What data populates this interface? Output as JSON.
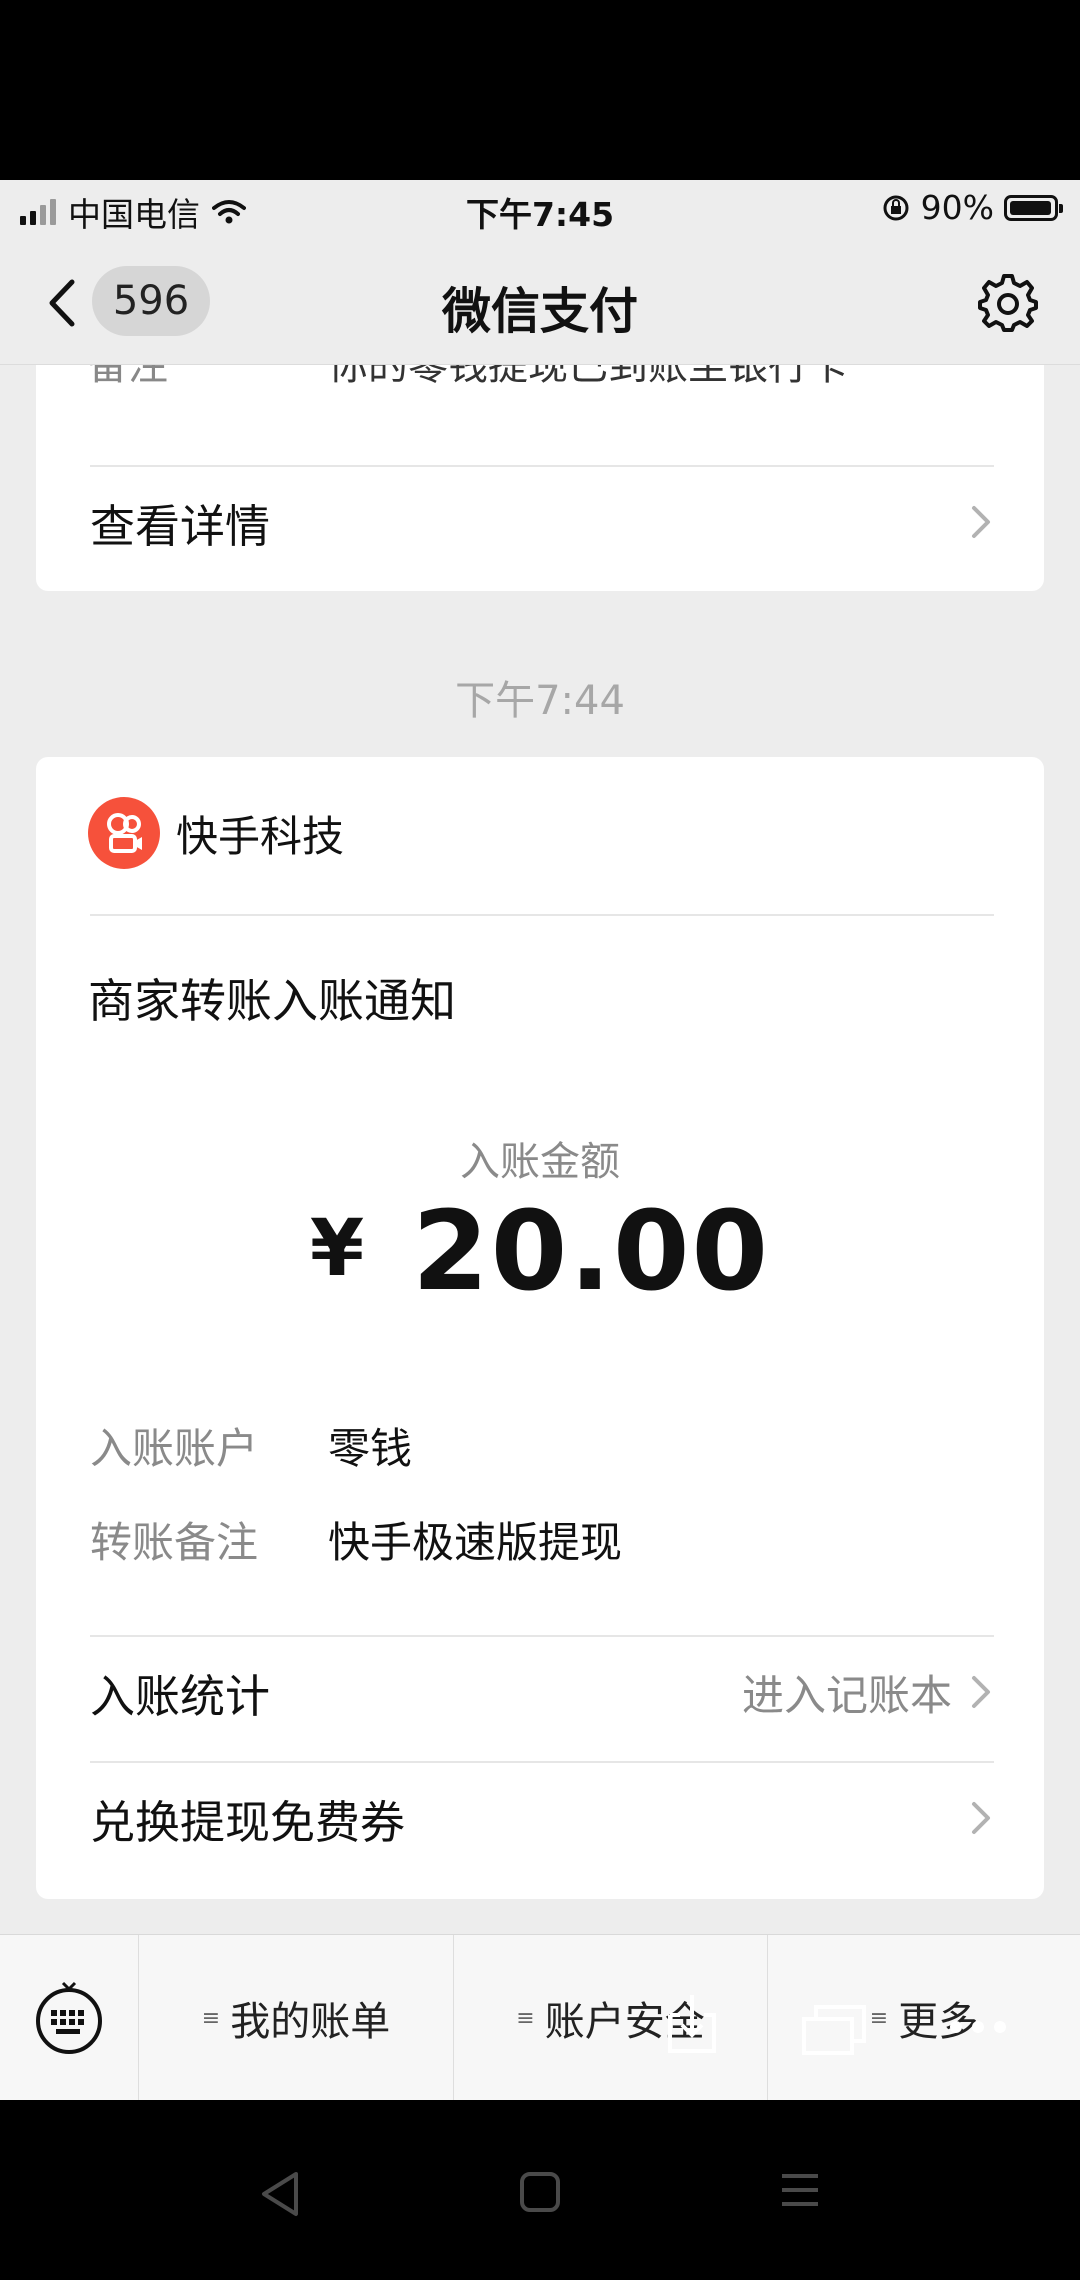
{
  "status_bar": {
    "carrier": "中国电信",
    "time": "下午7:45",
    "battery": "90%"
  },
  "nav": {
    "unread_count": "596",
    "title": "微信支付"
  },
  "previous_card": {
    "clipped_label": "备注",
    "clipped_value": "你的零钱提现已到账至银行卡",
    "detail_label": "查看详情"
  },
  "timestamp": "下午7:44",
  "notice_card": {
    "merchant": "快手科技",
    "title": "商家转账入账通知",
    "amount_label": "入账金额",
    "currency_symbol": "¥",
    "amount": "20.00",
    "fields": [
      {
        "key": "入账账户",
        "value": "零钱"
      },
      {
        "key": "转账备注",
        "value": "快手极速版提现"
      }
    ],
    "stats_label": "入账统计",
    "stats_hint": "进入记账本",
    "coupon_label": "兑换提现免费券"
  },
  "bottom_menu": {
    "items": [
      "我的账单",
      "账户安全",
      "更多"
    ],
    "menu_marker": "≡"
  },
  "colors": {
    "background": "#ededed",
    "card": "#ffffff",
    "brand_logo": "#f6513b"
  }
}
